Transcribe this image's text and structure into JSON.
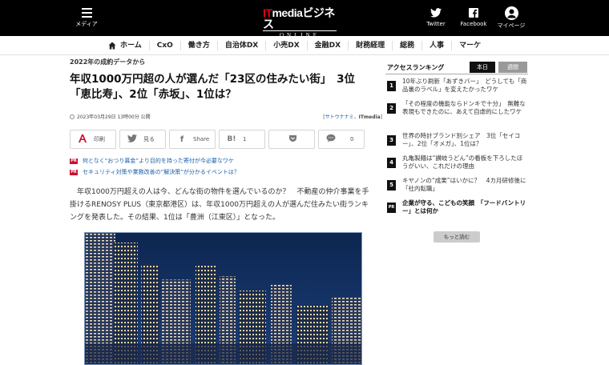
{
  "header": {
    "menu_label": "メディア",
    "logo_brand_it": "IT",
    "logo_brand_rest": "mediaビジネス",
    "logo_sub": "ONLINE",
    "twitter_label": "Twitter",
    "facebook_label": "Facebook",
    "mypage_label": "マイページ"
  },
  "nav": {
    "items": [
      "ホーム",
      "CxO",
      "働き方",
      "自治体DX",
      "小売DX",
      "金融DX",
      "財務経理",
      "総務",
      "人事",
      "マーケ"
    ]
  },
  "article": {
    "kicker": "2022年の成約データから",
    "headline_line1": "年収1000万円超の人が選んだ「23区の住みたい街」　3位",
    "headline_line2": "「恵比寿」、2位「赤坂」、1位は？",
    "date": "2023年03月29日 13時00分 公開",
    "author_open": "[",
    "author_name": "サトウナナミ",
    "author_sep": "，",
    "author_org": "ITmedia",
    "author_close": "]",
    "share": [
      {
        "icon": "print-icon",
        "label": "印刷"
      },
      {
        "icon": "twitter-icon",
        "label": "見る"
      },
      {
        "icon": "facebook-icon",
        "label": "Share"
      },
      {
        "icon": "hatena-icon",
        "label": "1",
        "glyph": "B!"
      },
      {
        "icon": "pocket-icon",
        "label": ""
      },
      {
        "icon": "comment-icon",
        "label": "0"
      }
    ],
    "promos": [
      {
        "badge": "PR",
        "text": "何となく“おつり募金”より目的を持った寄付が今必要なワケ"
      },
      {
        "badge": "PR",
        "text": "セキュリティ対策や業務改善の“解決策”が分かるイベントは？"
      }
    ],
    "lead": "年収1000万円超えの人は今、どんな街の物件を選んでいるのか？　不動産の仲介事業を手掛けるRENOSY PLUS（東京都港区）は、年収1000万円超えの人が選んだ住みたい街ランキングを発表した。その結果、1位は「豊洲（江東区）」となった。"
  },
  "sidebar": {
    "title": "アクセスランキング",
    "tab_today": "本日",
    "tab_week": "週間",
    "items": [
      {
        "num": "1",
        "text": "10年ぶり刷新「あずきバー」　どうしても「商品裏のラベル」を変えたかったワケ"
      },
      {
        "num": "2",
        "text": "「その程度の機能ならドンキで十分」　無難な表現もできたのに、あえて自虐的にしたワケ"
      },
      {
        "num": "3",
        "text": "世界の時計ブランド別シェア　3位「セイコー」、2位「オメガ」、1位は？"
      },
      {
        "num": "4",
        "text": "丸亀製麺は“讃岐うどん”の看板を下ろしたほうがいい、これだけの理由"
      },
      {
        "num": "5",
        "text": "キヤノンの“成果”はいかに？　4カ月研修後に「社内転職」"
      },
      {
        "num": "PR",
        "text": "企業が守る、こどもの笑顔　「フードバントリー」とは何か"
      }
    ],
    "more_label": "もっと読む"
  },
  "colors": {
    "header_bg": "#000000",
    "logo_accent": "#e60012",
    "link": "#1a5fa8",
    "pr_badge": "#c8102e"
  }
}
